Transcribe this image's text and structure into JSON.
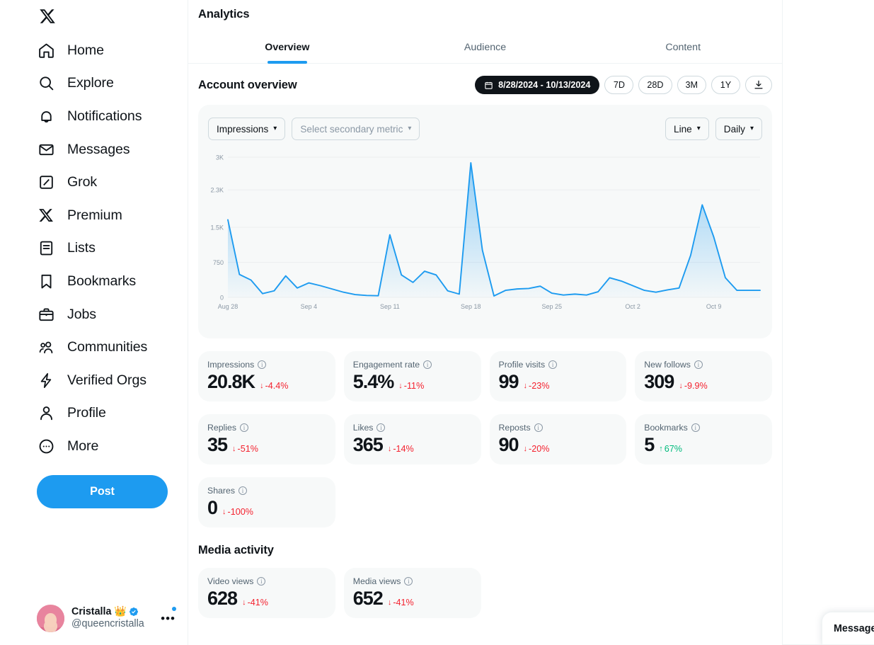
{
  "sidebar": {
    "logo_icon": "x-logo-icon",
    "items": [
      {
        "label": "Home",
        "icon": "home-icon"
      },
      {
        "label": "Explore",
        "icon": "search-icon"
      },
      {
        "label": "Notifications",
        "icon": "bell-icon"
      },
      {
        "label": "Messages",
        "icon": "envelope-icon"
      },
      {
        "label": "Grok",
        "icon": "grok-icon"
      },
      {
        "label": "Premium",
        "icon": "x-premium-icon"
      },
      {
        "label": "Lists",
        "icon": "lists-icon"
      },
      {
        "label": "Bookmarks",
        "icon": "bookmark-icon"
      },
      {
        "label": "Jobs",
        "icon": "briefcase-icon"
      },
      {
        "label": "Communities",
        "icon": "communities-icon"
      },
      {
        "label": "Verified Orgs",
        "icon": "lightning-badge-icon"
      },
      {
        "label": "Profile",
        "icon": "person-icon"
      },
      {
        "label": "More",
        "icon": "more-circle-icon"
      }
    ],
    "post_button": "Post",
    "account": {
      "name": "Cristalla 👑",
      "handle": "@queencristalla",
      "verified_icon": "verified-badge-icon",
      "more_icon": "more-dots-icon"
    }
  },
  "header": {
    "title": "Analytics",
    "tabs": [
      {
        "label": "Overview",
        "active": true
      },
      {
        "label": "Audience",
        "active": false
      },
      {
        "label": "Content",
        "active": false
      }
    ]
  },
  "account_overview": {
    "title": "Account overview",
    "date_range": "8/28/2024 - 10/13/2024",
    "calendar_icon": "calendar-icon",
    "range_options": [
      "7D",
      "28D",
      "3M",
      "1Y"
    ],
    "download_icon": "download-icon"
  },
  "chart_controls": {
    "primary_metric": "Impressions",
    "secondary_metric_placeholder": "Select secondary metric",
    "chart_type": "Line",
    "granularity": "Daily",
    "chevron_icon": "chevron-down-icon"
  },
  "chart_data": {
    "type": "area",
    "title": "Impressions",
    "xlabel": "",
    "ylabel": "",
    "ylim": [
      0,
      3000
    ],
    "ytick_labels": [
      "0",
      "750",
      "1.5K",
      "2.3K",
      "3K"
    ],
    "ytick_values": [
      0,
      750,
      1500,
      2300,
      3000
    ],
    "xtick_labels": [
      "Aug 28",
      "Sep 4",
      "Sep 11",
      "Sep 18",
      "Sep 25",
      "Oct 2",
      "Oct 9"
    ],
    "xtick_indices": [
      0,
      7,
      14,
      21,
      28,
      35,
      42
    ],
    "grid": true,
    "legend": "none",
    "line_color": "#1d9bf0",
    "fill_color": "#1d9bf0",
    "x": [
      "Aug 28",
      "Aug 29",
      "Aug 30",
      "Aug 31",
      "Sep 1",
      "Sep 2",
      "Sep 3",
      "Sep 4",
      "Sep 5",
      "Sep 6",
      "Sep 7",
      "Sep 8",
      "Sep 9",
      "Sep 10",
      "Sep 11",
      "Sep 12",
      "Sep 13",
      "Sep 14",
      "Sep 15",
      "Sep 16",
      "Sep 17",
      "Sep 18",
      "Sep 19",
      "Sep 20",
      "Sep 21",
      "Sep 22",
      "Sep 23",
      "Sep 24",
      "Sep 25",
      "Sep 26",
      "Sep 27",
      "Sep 28",
      "Sep 29",
      "Sep 30",
      "Oct 1",
      "Oct 2",
      "Oct 3",
      "Oct 4",
      "Oct 5",
      "Oct 6",
      "Oct 7",
      "Oct 8",
      "Oct 9",
      "Oct 10",
      "Oct 11",
      "Oct 12",
      "Oct 13"
    ],
    "values": [
      1660,
      490,
      370,
      80,
      140,
      460,
      200,
      310,
      250,
      180,
      110,
      60,
      40,
      35,
      1340,
      480,
      320,
      560,
      480,
      140,
      70,
      2880,
      1010,
      30,
      150,
      180,
      190,
      240,
      90,
      50,
      70,
      50,
      120,
      420,
      350,
      250,
      150,
      110,
      160,
      200,
      900,
      1980,
      1290,
      420,
      150,
      150,
      150
    ]
  },
  "metrics": [
    {
      "label": "Impressions",
      "value": "20.8K",
      "delta": "-4.4%",
      "direction": "down"
    },
    {
      "label": "Engagement rate",
      "value": "5.4%",
      "delta": "-11%",
      "direction": "down"
    },
    {
      "label": "Profile visits",
      "value": "99",
      "delta": "-23%",
      "direction": "down"
    },
    {
      "label": "New follows",
      "value": "309",
      "delta": "-9.9%",
      "direction": "down"
    },
    {
      "label": "Replies",
      "value": "35",
      "delta": "-51%",
      "direction": "down"
    },
    {
      "label": "Likes",
      "value": "365",
      "delta": "-14%",
      "direction": "down"
    },
    {
      "label": "Reposts",
      "value": "90",
      "delta": "-20%",
      "direction": "down"
    },
    {
      "label": "Bookmarks",
      "value": "5",
      "delta": "67%",
      "direction": "up"
    },
    {
      "label": "Shares",
      "value": "0",
      "delta": "-100%",
      "direction": "down"
    }
  ],
  "media_activity": {
    "title": "Media activity",
    "metrics": [
      {
        "label": "Video views",
        "value": "628",
        "delta": "-41%",
        "direction": "down"
      },
      {
        "label": "Media views",
        "value": "652",
        "delta": "-41%",
        "direction": "down"
      }
    ]
  },
  "messages_dock": {
    "label": "Messages"
  },
  "colors": {
    "accent": "#1d9bf0",
    "text": "#0f1419",
    "muted": "#536471",
    "down": "#f4212e",
    "up": "#00ba7c",
    "card_bg": "#f7f9f9",
    "border": "#eff3f4"
  }
}
